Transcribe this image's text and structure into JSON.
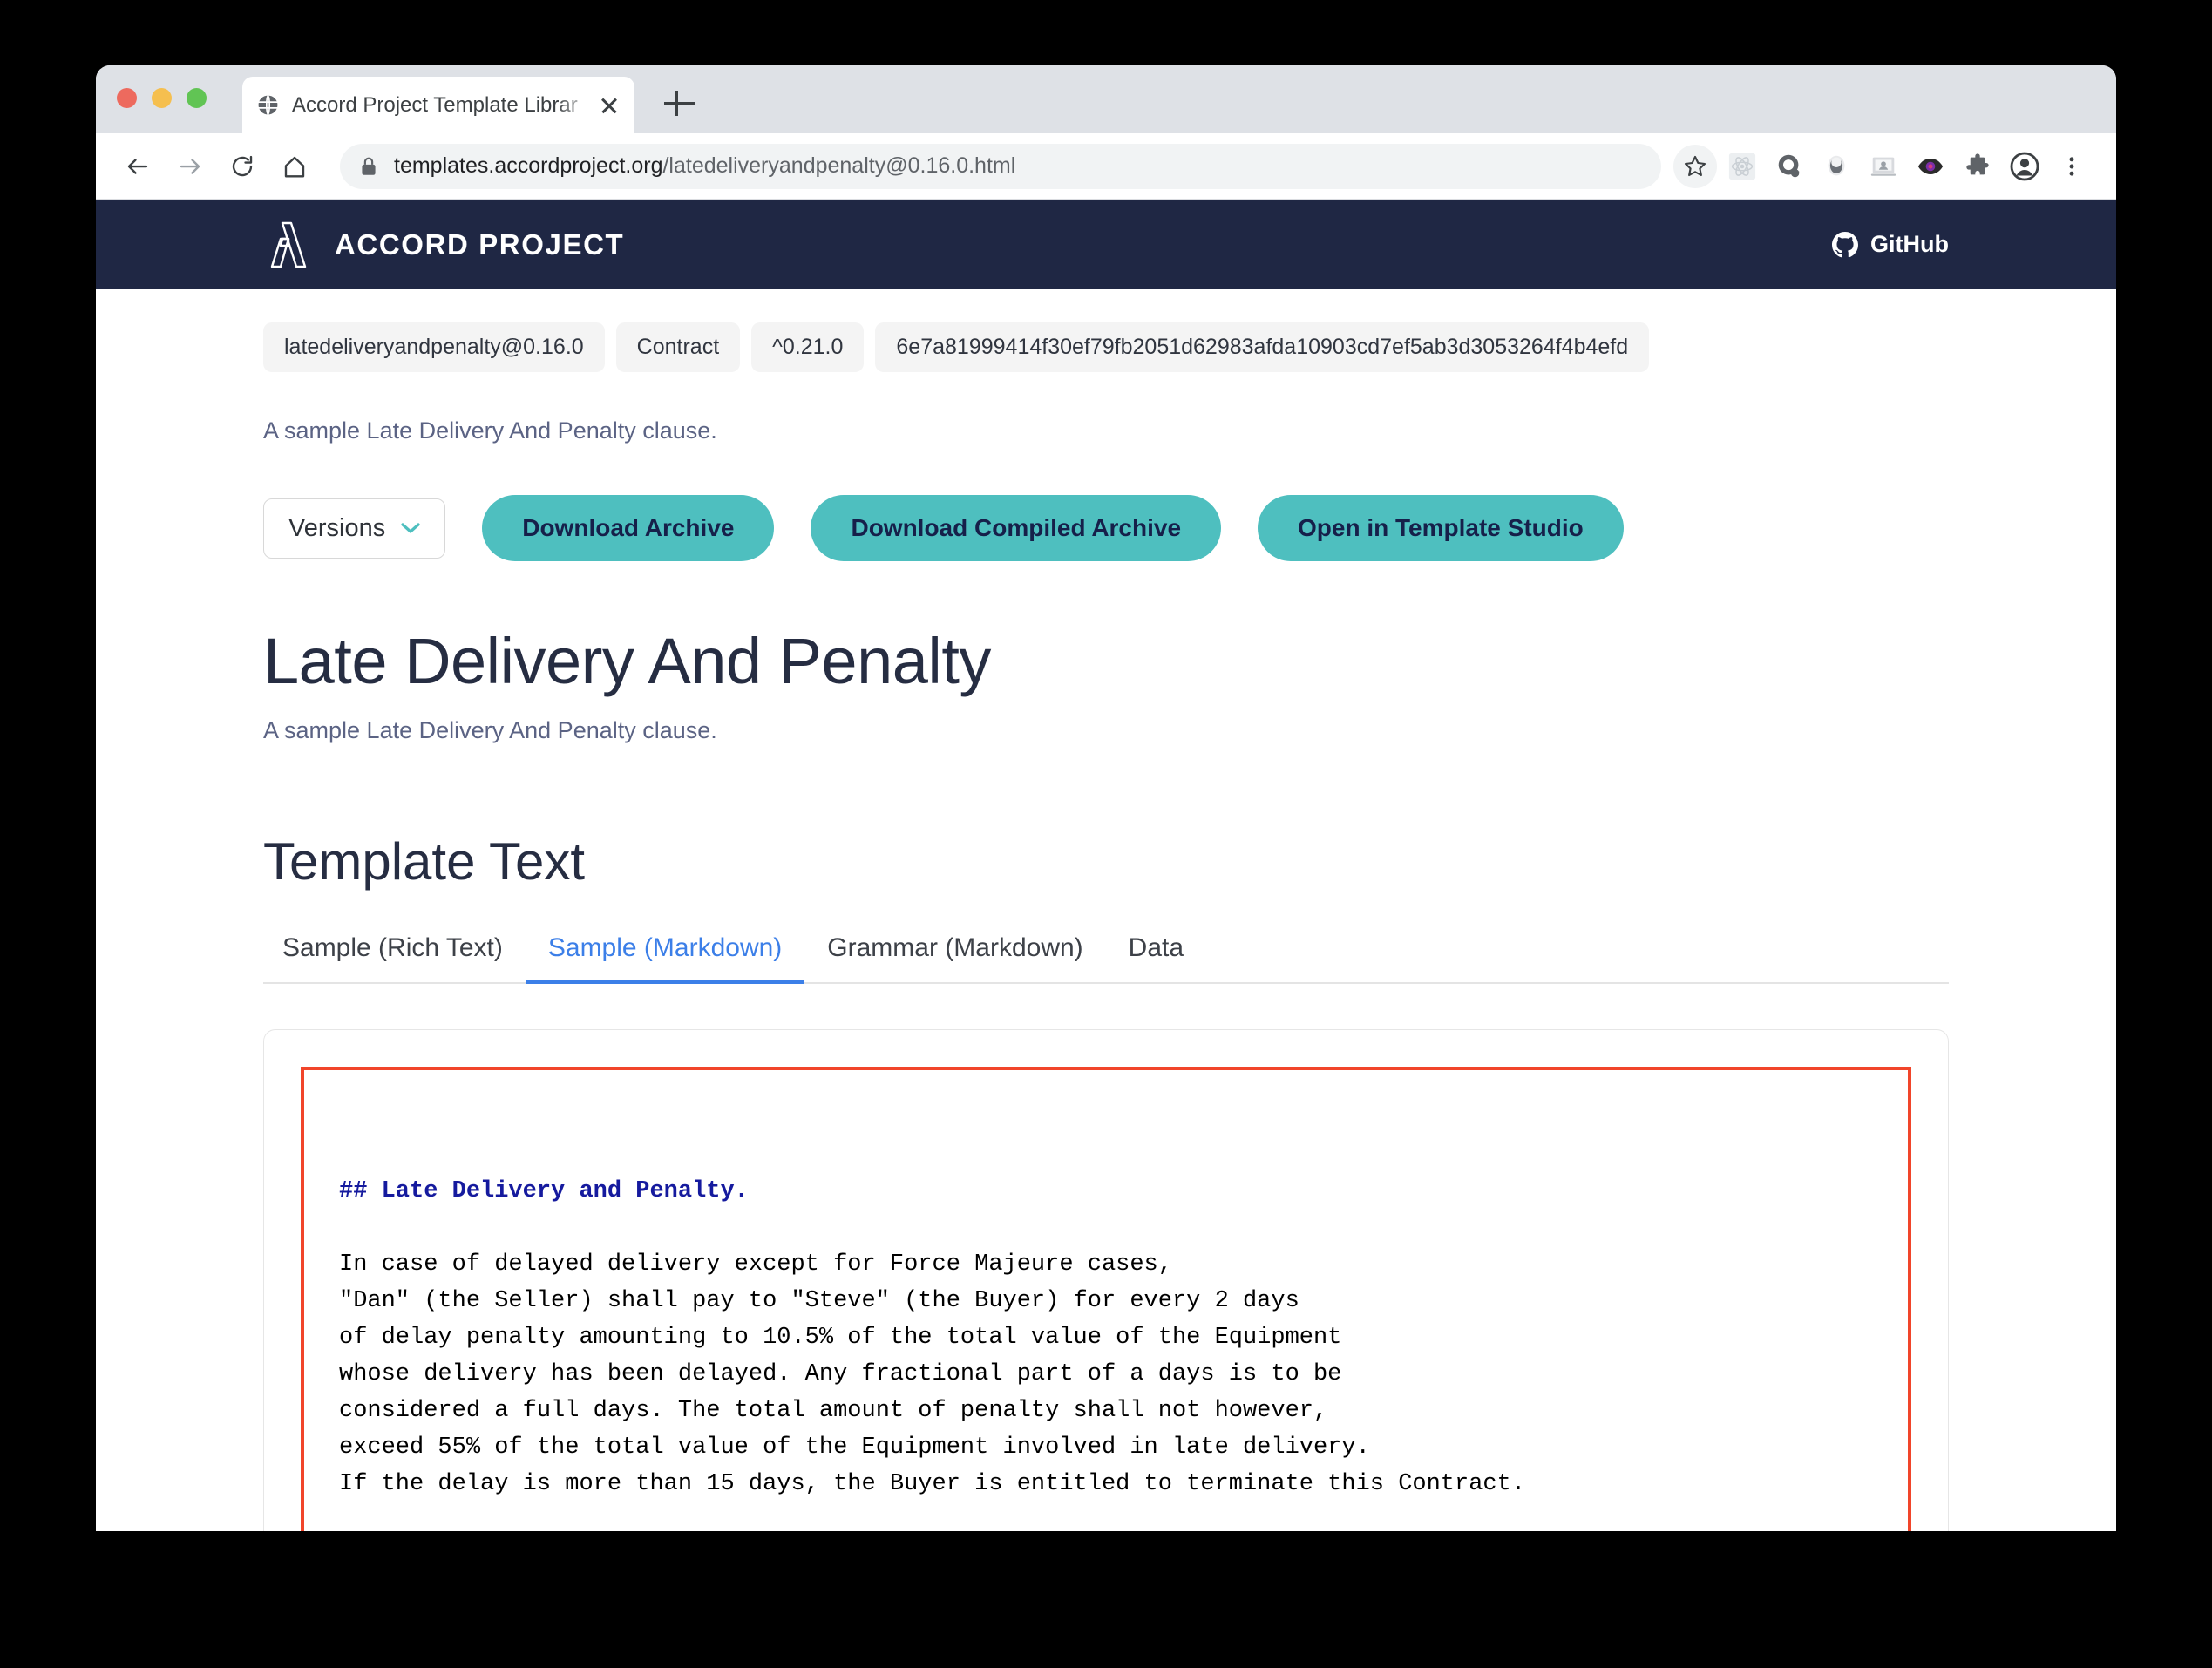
{
  "browser": {
    "tab": {
      "title": "Accord Project Template Librar",
      "favicon": "globe-icon"
    },
    "url_domain": "templates.accordproject.org",
    "url_path": "/latedeliveryandpenalty@0.16.0.html",
    "icons": [
      "bookmark-star-icon",
      "react-devtools-icon",
      "extension-circle-icon",
      "extension-oval-icon",
      "screencast-icon",
      "eye-icon",
      "puzzle-piece-icon",
      "profile-avatar-icon",
      "three-dot-menu-icon"
    ]
  },
  "site_header": {
    "brand": "ACCORD PROJECT",
    "github_label": "GitHub"
  },
  "badges": [
    "latedeliveryandpenalty@0.16.0",
    "Contract",
    "^0.21.0",
    "6e7a81999414f30ef79fb2051d62983afda10903cd7ef5ab3d3053264f4b4efd"
  ],
  "top_description": "A sample Late Delivery And Penalty clause.",
  "actions": {
    "versions_label": "Versions",
    "download_archive": "Download Archive",
    "download_compiled_archive": "Download Compiled Archive",
    "open_in_template_studio": "Open in Template Studio"
  },
  "main": {
    "title": "Late Delivery And Penalty",
    "description": "A sample Late Delivery And Penalty clause.",
    "section_title": "Template Text",
    "tabs": [
      {
        "label": "Sample (Rich Text)",
        "active": false
      },
      {
        "label": "Sample (Markdown)",
        "active": true
      },
      {
        "label": "Grammar (Markdown)",
        "active": false
      },
      {
        "label": "Data",
        "active": false
      }
    ]
  },
  "code": {
    "heading": "## Late Delivery and Penalty.",
    "body": "In case of delayed delivery except for Force Majeure cases,\n\"Dan\" (the Seller) shall pay to \"Steve\" (the Buyer) for every 2 days\nof delay penalty amounting to 10.5% of the total value of the Equipment\nwhose delivery has been delayed. Any fractional part of a days is to be\nconsidered a full days. The total amount of penalty shall not however,\nexceed 55% of the total value of the Equipment involved in late delivery.\nIf the delay is more than 15 days, the Buyer is entitled to terminate this Contract."
  },
  "colors": {
    "header_navy": "#1f2744",
    "accent_teal": "#4ebfbf",
    "active_tab_blue": "#3c7fe8",
    "highlight_red": "#f1452a",
    "code_heading_blue": "#151a9e"
  }
}
